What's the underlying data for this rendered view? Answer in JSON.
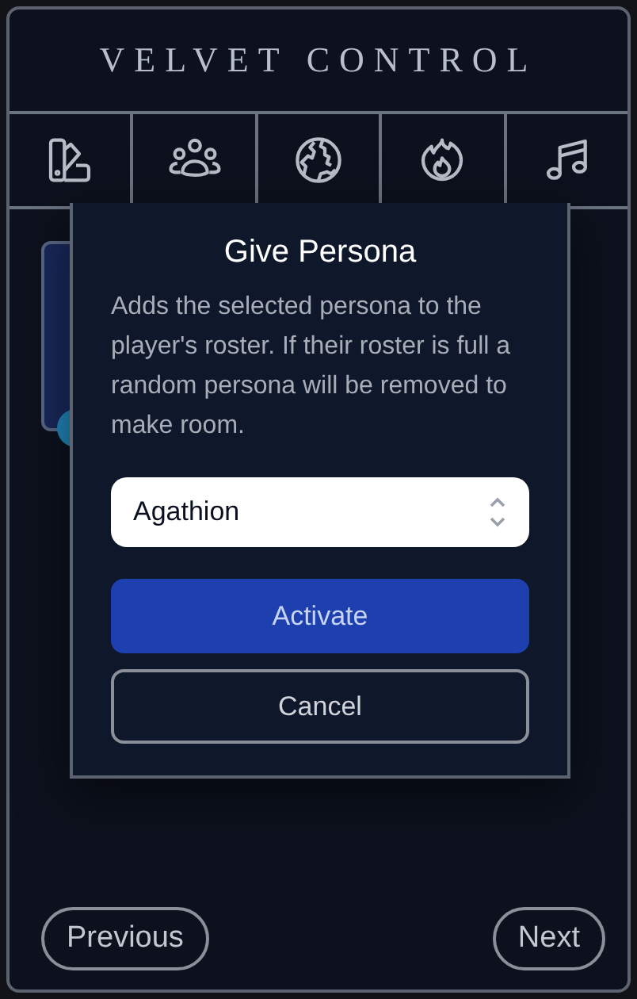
{
  "window": {
    "title": "VELVET CONTROL"
  },
  "tabs": [
    {
      "kind": "palette"
    },
    {
      "kind": "group"
    },
    {
      "kind": "globe"
    },
    {
      "kind": "fire"
    },
    {
      "kind": "music"
    }
  ],
  "dialog": {
    "title": "Give Persona",
    "description": "Adds the selected persona to the player's roster. If their roster is full a random persona will be removed to make room.",
    "select": {
      "value": "Agathion"
    },
    "buttons": [
      {
        "label": "Activate",
        "kind": "primary"
      },
      {
        "label": "Cancel",
        "kind": "secondary"
      }
    ]
  },
  "footer": {
    "previous": "Previous",
    "next": "Next"
  }
}
